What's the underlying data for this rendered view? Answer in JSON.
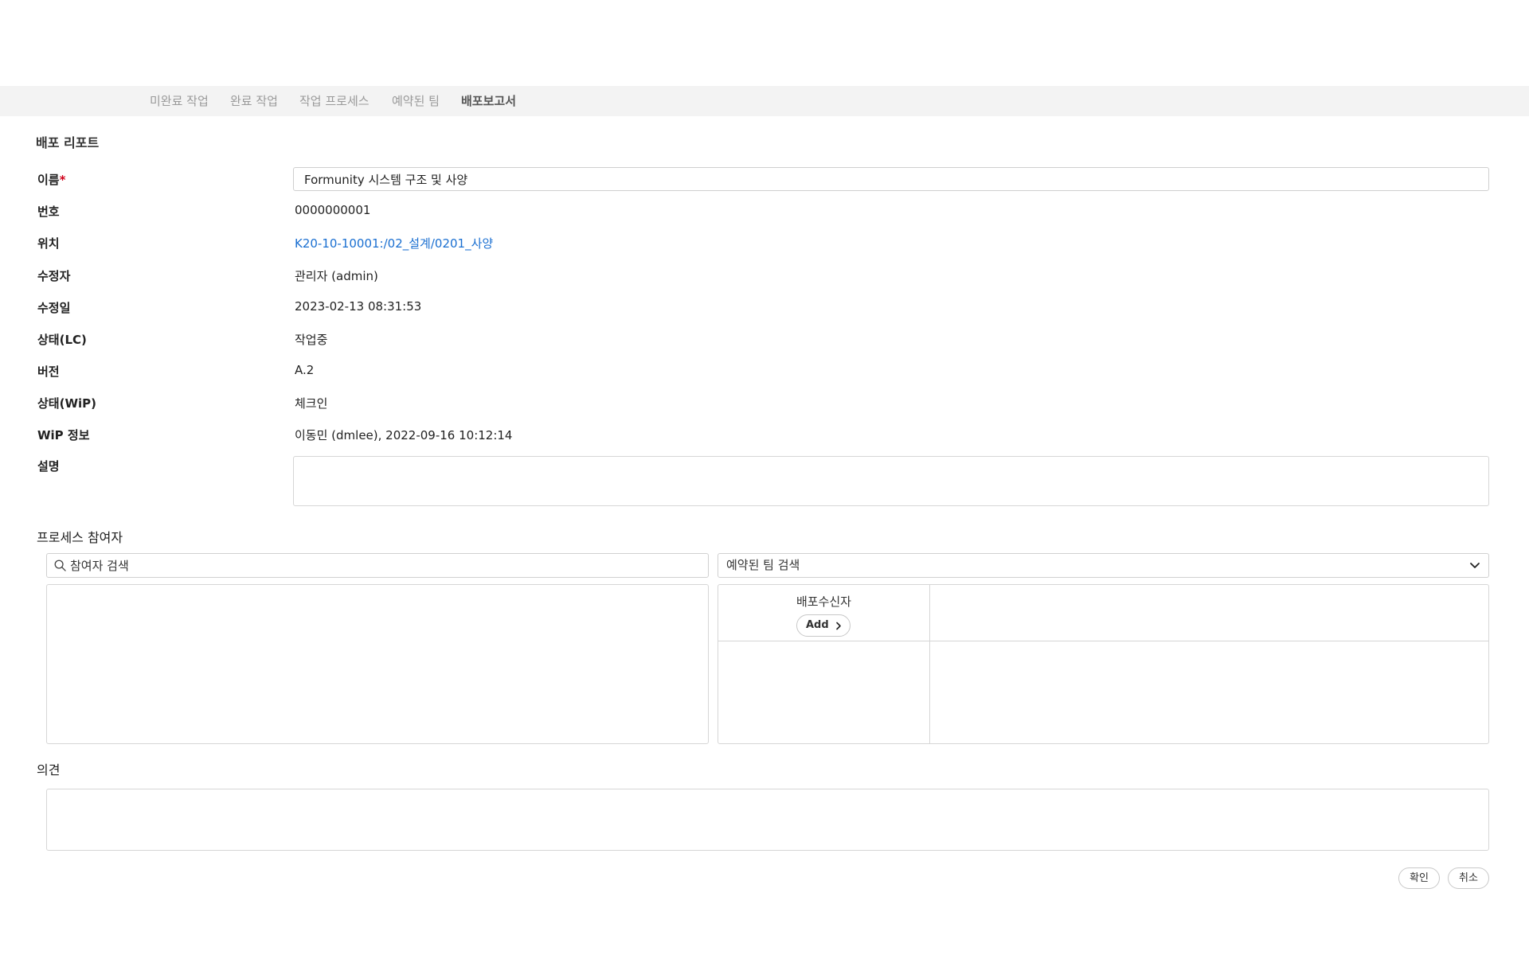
{
  "tabs": [
    {
      "label": "미완료 작업",
      "active": false
    },
    {
      "label": "완료 작업",
      "active": false
    },
    {
      "label": "작업 프로세스",
      "active": false
    },
    {
      "label": "예약된 팀",
      "active": false
    },
    {
      "label": "배포보고서",
      "active": true
    }
  ],
  "report": {
    "title": "배포 리포트",
    "name_label": "이름",
    "required_mark": "*",
    "name_value": "Formunity 시스템 구조 및 사양",
    "fields": [
      {
        "label": "번호",
        "value": "0000000001"
      },
      {
        "label": "위치",
        "value": "K20-10-10001:/02_설계/0201_사양"
      },
      {
        "label": "수정자",
        "value": "관리자 (admin)"
      },
      {
        "label": "수정일",
        "value": "2023-02-13 08:31:53"
      },
      {
        "label": "상태(LC)",
        "value": "작업중"
      },
      {
        "label": "버전",
        "value": "A.2"
      },
      {
        "label": "상태(WiP)",
        "value": "체크인"
      },
      {
        "label": "WiP 정보",
        "value": "이동민 (dmlee), 2022-09-16 10:12:14"
      }
    ],
    "description_label": "설명",
    "description_value": ""
  },
  "participants": {
    "title": "프로세스 참여자",
    "search_placeholder": "참여자 검색",
    "team_select_value": "예약된 팀 검색",
    "receiver_label": "배포수신자",
    "add_label": "Add"
  },
  "opinion": {
    "title": "의견",
    "value": ""
  },
  "actions": {
    "confirm_label": "확인",
    "cancel_label": "취소"
  },
  "colors": {
    "link": "#1a6fd1",
    "required": "#d0021b",
    "tabbar_bg": "#f3f3f3"
  }
}
